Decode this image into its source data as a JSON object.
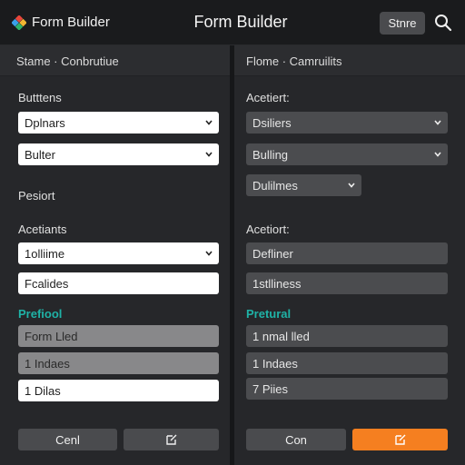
{
  "header": {
    "app_name": "Form Builder",
    "title": "Form Builder",
    "store_label": "Stnre"
  },
  "left": {
    "breadcrumb": "Stame  ·  Conbrutiue",
    "section1_label": "Butttens",
    "select1_value": "Dplnars",
    "select2_value": "Bulter",
    "section2_label": "Pesiort",
    "section3_label": "Acetiants",
    "select3_value": "1olliime",
    "input1_value": "Fcalides",
    "section4_label": "Prefiool",
    "row1_value": "Form Lled",
    "row2_value": "1 Indaes",
    "row3_value": "1 Dilas",
    "cancel_label": "Cenl"
  },
  "right": {
    "breadcrumb": "Flome  ·  Camruilits",
    "section1_label": "Acetiert:",
    "select1_value": "Dsiliers",
    "select2_value": "Bulling",
    "select3_value": "Dulilmes",
    "section2_label": "Acetiort:",
    "field1_value": "Defliner",
    "field2_value": "1stlliness",
    "section3_label": "Pretural",
    "row1_value": "1 nmal lled",
    "row2_value": "1 Indaes",
    "row3_value": "7 Piies",
    "confirm_label": "Con"
  },
  "colors": {
    "accent_teal": "#1fb2a6",
    "accent_orange": "#f57f20",
    "background": "#26272a"
  },
  "icons": {
    "logo": "app-logo-icon",
    "search": "search-icon",
    "chevron": "chevron-down-icon",
    "action": "edit-box-icon"
  }
}
